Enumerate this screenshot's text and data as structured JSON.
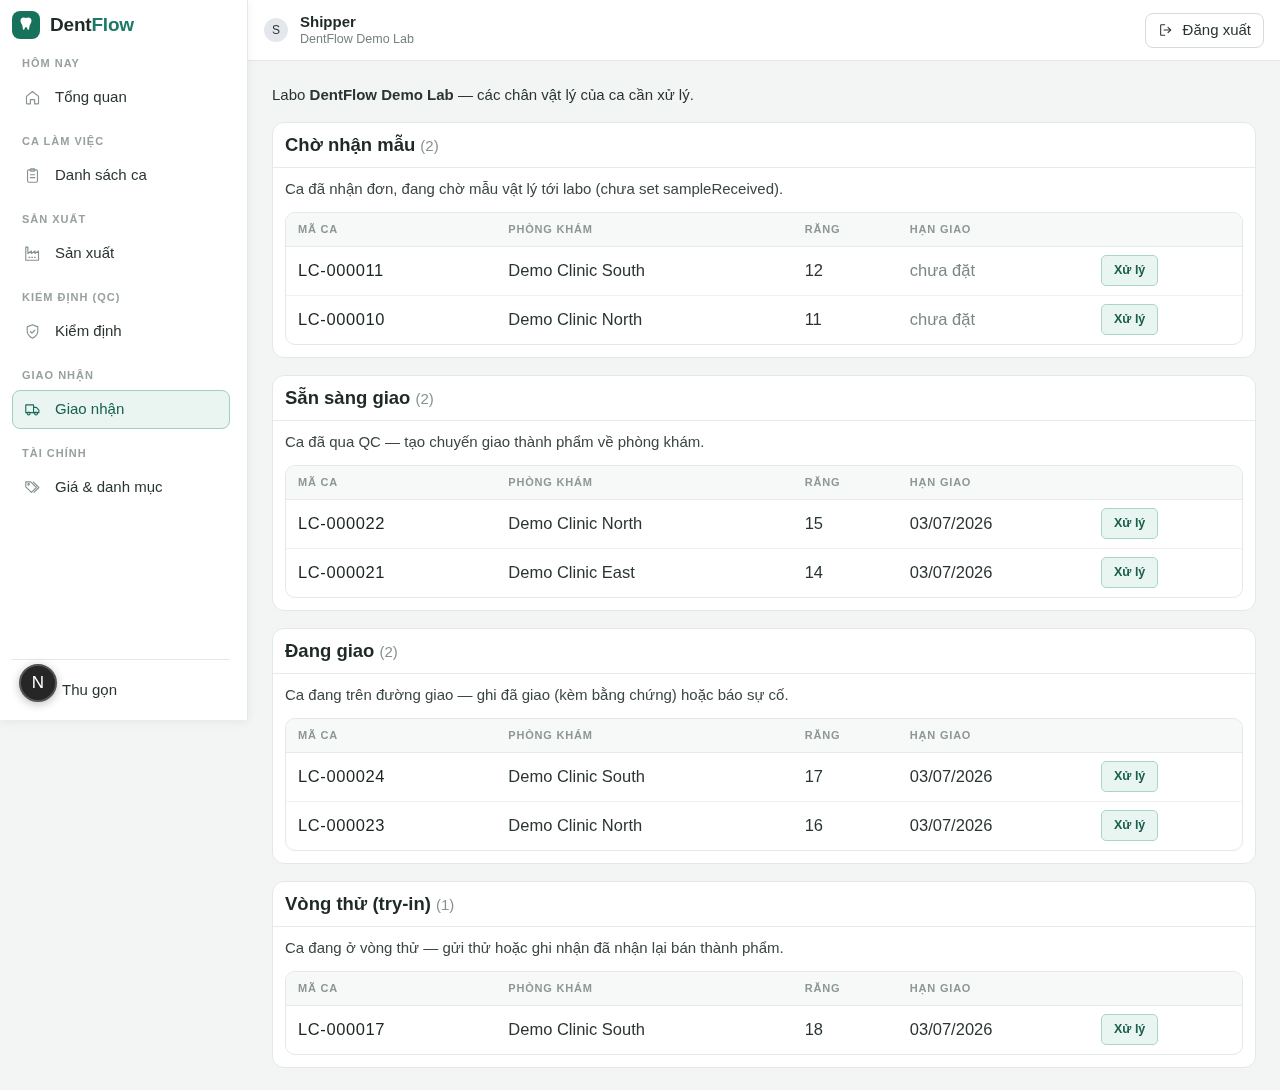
{
  "sidebar": {
    "logo": {
      "text": "Dent",
      "accent": "Flow"
    },
    "sections": [
      {
        "label": "HÔM NAY",
        "items": [
          {
            "label": "Tổng quan",
            "selected": false
          }
        ]
      },
      {
        "label": "CA LÀM VIỆC",
        "items": [
          {
            "label": "Danh sách ca",
            "selected": false
          }
        ]
      },
      {
        "label": "SẢN XUẤT",
        "items": [
          {
            "label": "Sản xuất",
            "selected": false
          }
        ]
      },
      {
        "label": "KIỂM ĐỊNH (QC)",
        "items": [
          {
            "label": "Kiểm định",
            "selected": false
          }
        ]
      },
      {
        "label": "GIAO NHẬN",
        "items": [
          {
            "label": "Giao nhận",
            "selected": true
          }
        ]
      },
      {
        "label": "TÀI CHÍNH",
        "items": [
          {
            "label": "Giá & danh mục",
            "selected": false
          }
        ]
      }
    ],
    "collapse_label": "Thu gọn"
  },
  "dev_badge": "N",
  "header": {
    "avatar": "S",
    "role": "Shipper",
    "lab": "DentFlow Demo Lab",
    "logout": "Đăng xuất"
  },
  "intro": "Labo **DentFlow Demo Lab** — các chân vật lý của ca cần xử lý.",
  "sections": [
    {
      "title": "Chờ nhận mẫu",
      "count": "(2)",
      "description": "Ca đã nhận đơn, đang chờ mẫu vật lý tới labo (chưa set sampleReceived).",
      "columns": [
        "MÃ CA",
        "PHÒNG KHÁM",
        "RĂNG",
        "HẠN GIAO"
      ],
      "rows": [
        {
          "case": "LC-000011",
          "clinic": "Demo Clinic South",
          "teeth": "12",
          "due": "chưa đặt",
          "due_set": false,
          "action": "Xử lý"
        },
        {
          "case": "LC-000010",
          "clinic": "Demo Clinic North",
          "teeth": "11",
          "due": "chưa đặt",
          "due_set": false,
          "action": "Xử lý"
        }
      ]
    },
    {
      "title": "Sẵn sàng giao",
      "count": "(2)",
      "description": "Ca đã qua QC — tạo chuyến giao thành phẩm về phòng khám.",
      "columns": [
        "MÃ CA",
        "PHÒNG KHÁM",
        "RĂNG",
        "HẠN GIAO"
      ],
      "rows": [
        {
          "case": "LC-000022",
          "clinic": "Demo Clinic North",
          "teeth": "15",
          "due": "03/07/2026",
          "due_set": true,
          "action": "Xử lý"
        },
        {
          "case": "LC-000021",
          "clinic": "Demo Clinic East",
          "teeth": "14",
          "due": "03/07/2026",
          "due_set": true,
          "action": "Xử lý"
        }
      ]
    },
    {
      "title": "Đang giao",
      "count": "(2)",
      "description": "Ca đang trên đường giao — ghi đã giao (kèm bằng chứng) hoặc báo sự cố.",
      "columns": [
        "MÃ CA",
        "PHÒNG KHÁM",
        "RĂNG",
        "HẠN GIAO"
      ],
      "rows": [
        {
          "case": "LC-000024",
          "clinic": "Demo Clinic South",
          "teeth": "17",
          "due": "03/07/2026",
          "due_set": true,
          "action": "Xử lý"
        },
        {
          "case": "LC-000023",
          "clinic": "Demo Clinic North",
          "teeth": "16",
          "due": "03/07/2026",
          "due_set": true,
          "action": "Xử lý"
        }
      ]
    },
    {
      "title": "Vòng thử (try-in)",
      "count": "(1)",
      "description": "Ca đang ở vòng thử — gửi thử hoặc ghi nhận đã nhận lại bán thành phẩm.",
      "columns": [
        "MÃ CA",
        "PHÒNG KHÁM",
        "RĂNG",
        "HẠN GIAO"
      ],
      "rows": [
        {
          "case": "LC-000017",
          "clinic": "Demo Clinic South",
          "teeth": "18",
          "due": "03/07/2026",
          "due_set": true,
          "action": "Xử lý"
        }
      ]
    }
  ]
}
